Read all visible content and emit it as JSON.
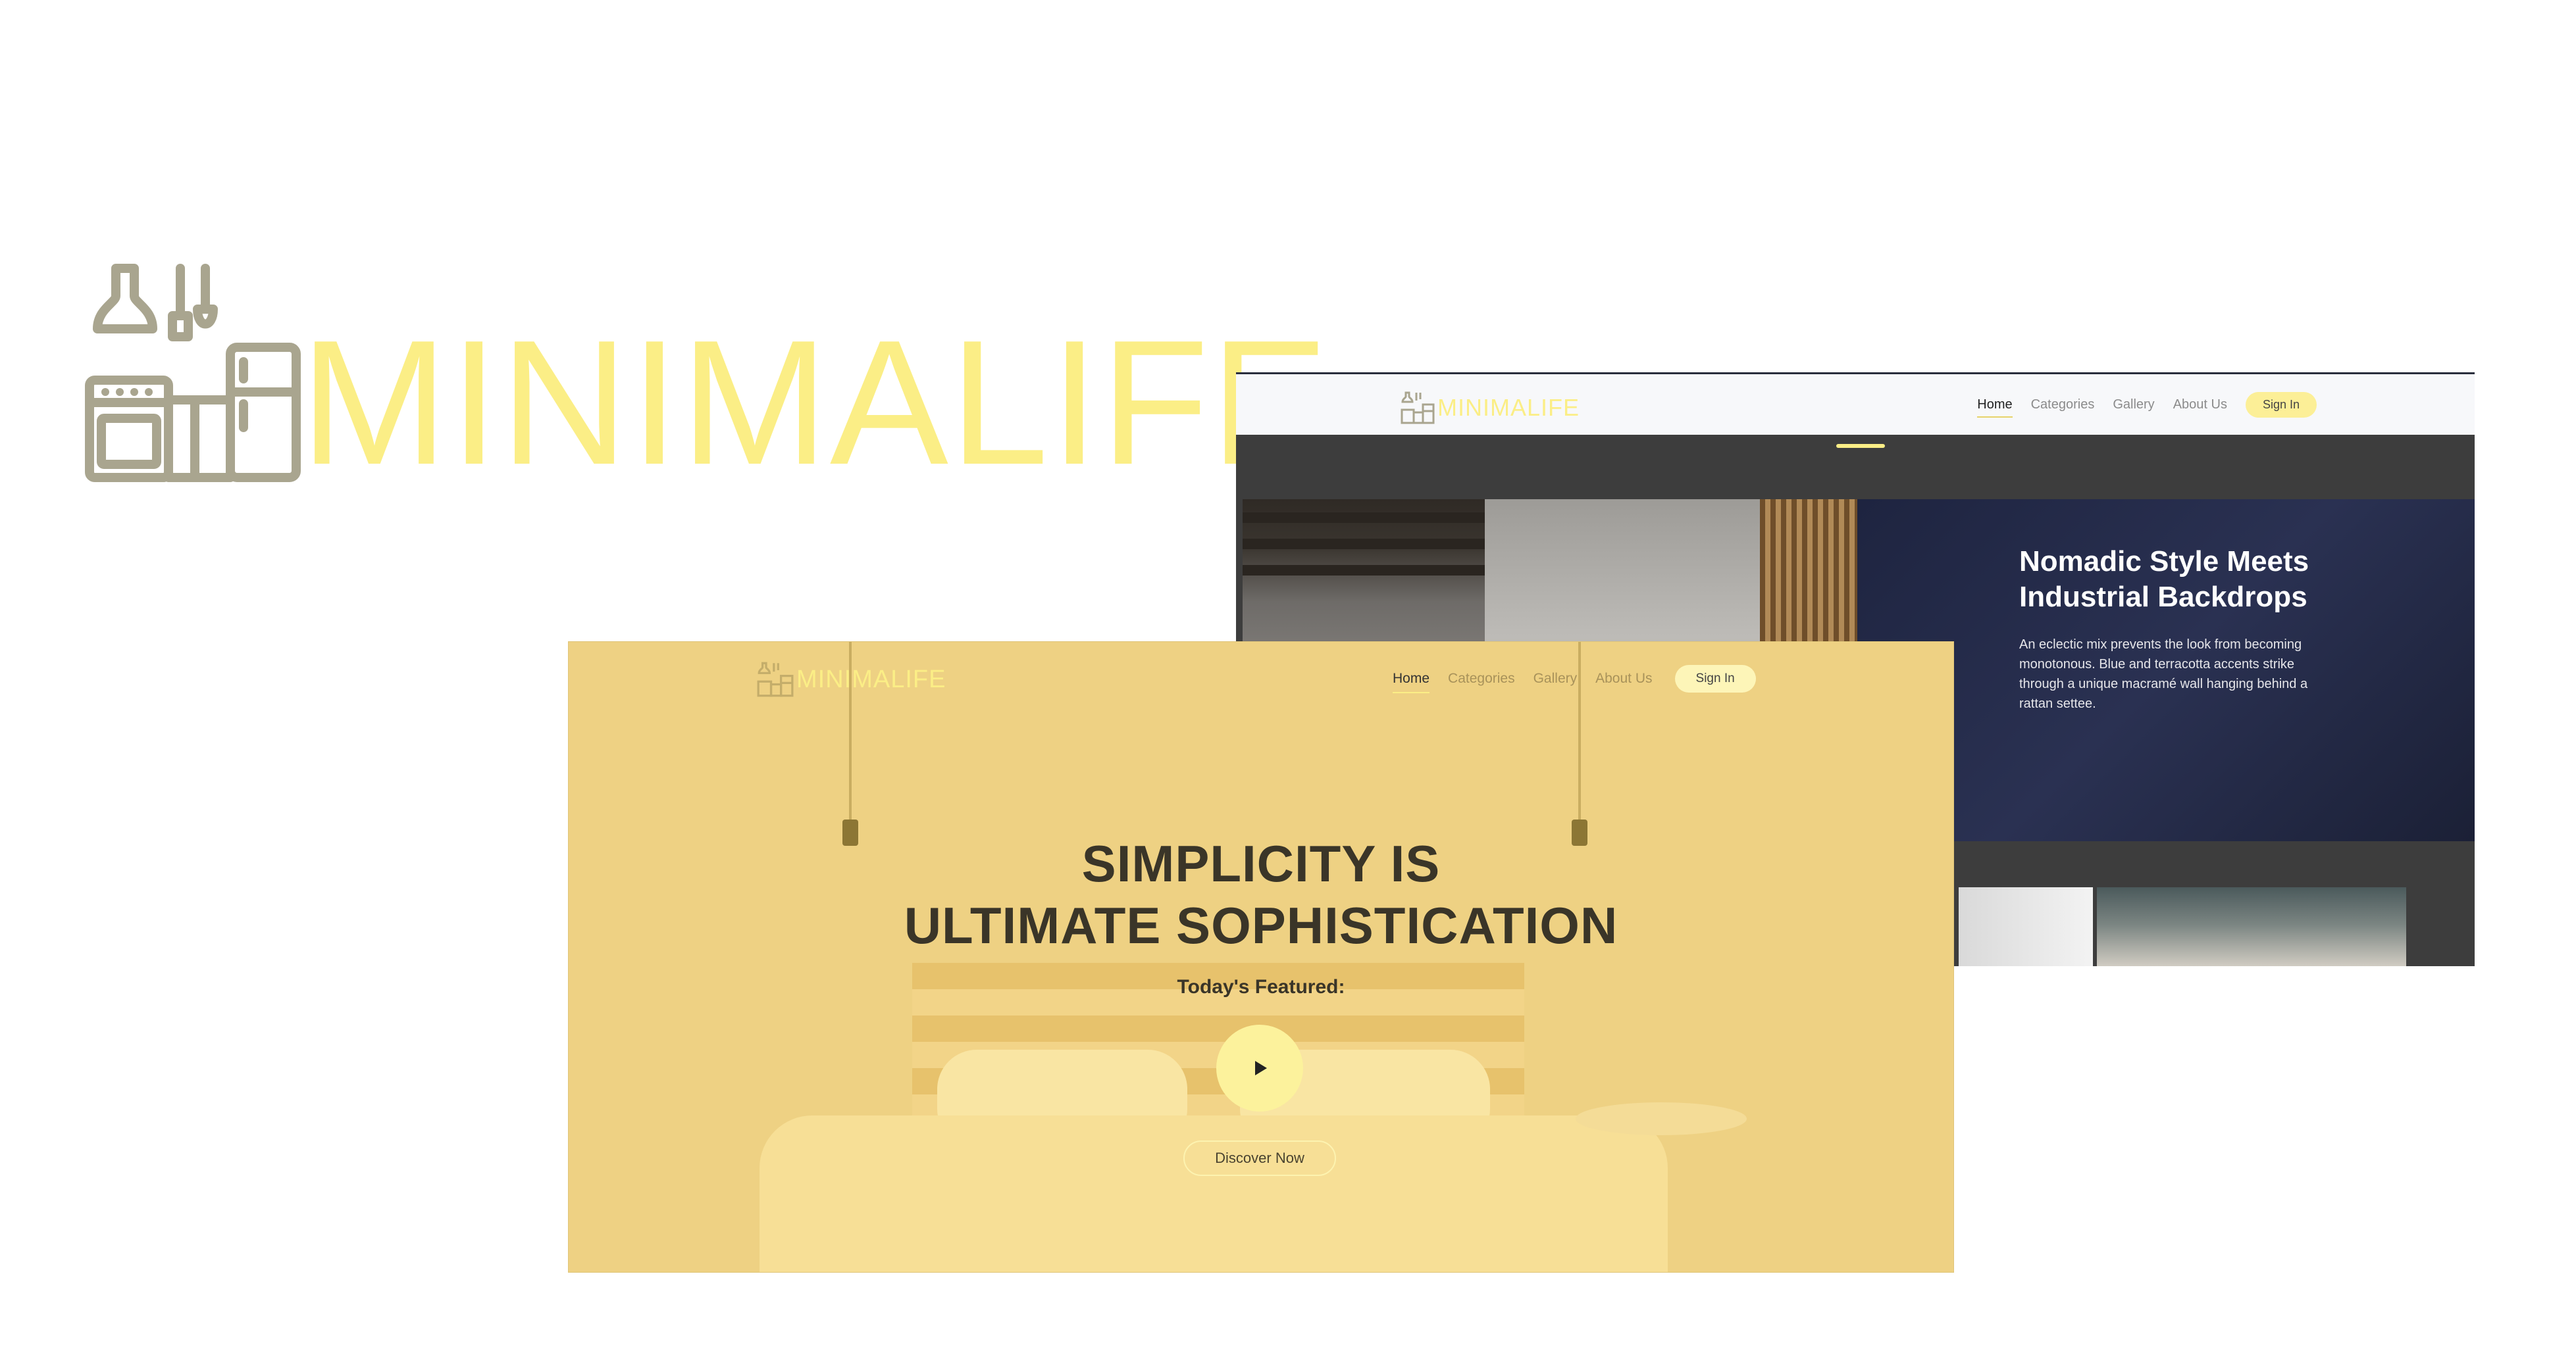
{
  "brand": {
    "name": "MINIMALIFE",
    "logo_icon": "kitchen-appliances-icon",
    "colors": {
      "wordmark": "#fbee86",
      "icon": "#a9a58f"
    }
  },
  "back_screenshot": {
    "nav": {
      "logo_text": "MINIMALIFE",
      "links": [
        "Home",
        "Categories",
        "Gallery",
        "About Us"
      ],
      "active": "Home",
      "signin": "Sign In"
    },
    "hero": {
      "title": "Nomadic Style Meets Industrial Backdrops",
      "body": "An eclectic mix prevents the look from becoming monotonous. Blue and terracotta accents strike through a unique macramé wall hanging behind a rattan settee."
    }
  },
  "front_screenshot": {
    "nav": {
      "logo_text": "MINIMALIFE",
      "links": [
        "Home",
        "Categories",
        "Gallery",
        "About Us"
      ],
      "active": "Home",
      "signin": "Sign In"
    },
    "headline_line1": "SIMPLICITY IS",
    "headline_line2": "ULTIMATE SOPHISTICATION",
    "featured_label": "Today's Featured:",
    "play_icon": "play-icon",
    "cta": "Discover Now",
    "overlay_color": "#eed183"
  }
}
